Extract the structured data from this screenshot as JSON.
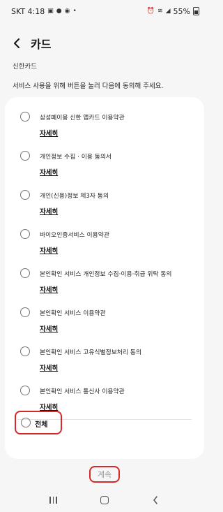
{
  "status_bar": {
    "carrier_time": "SKT 4:18",
    "notification_dot": "•",
    "battery": "55%",
    "left_icons": [
      "gallery-icon",
      "chat-icon",
      "message-icon"
    ],
    "right_icons": [
      "alarm-icon",
      "wifi-icon",
      "signal-icon",
      "battery-icon"
    ]
  },
  "header": {
    "title": "카드",
    "back_icon": "chevron-left-icon"
  },
  "card_name": "신한카드",
  "instruction": "서비스 사용을 위해 버튼을 눌러 다음에 동의해 주세요.",
  "terms": [
    {
      "label": "삼성페이용 신한 앱카드 이용약관",
      "detail": "자세히"
    },
    {
      "label": "개인정보 수집 · 이용 동의서",
      "detail": "자세히"
    },
    {
      "label": "개인(신용)정보 제3자 동의",
      "detail": "자세히"
    },
    {
      "label": "바이오인증서비스 이용약관",
      "detail": "자세히"
    },
    {
      "label": "본인확인 서비스 개인정보 수집·이용·취급 위탁 동의",
      "detail": "자세히"
    },
    {
      "label": "본인확인 서비스 이용약관",
      "detail": "자세히"
    },
    {
      "label": "본인확인 서비스 고유식별정보처리 동의",
      "detail": "자세히"
    },
    {
      "label": "본인확인 서비스 통신사 이용약관",
      "detail": "자세히"
    }
  ],
  "all_label": "전체",
  "continue_label": "계속",
  "colors": {
    "highlight": "#d62828",
    "background": "#f6f6f6",
    "card": "#ffffff",
    "disabled_text": "#999999"
  }
}
